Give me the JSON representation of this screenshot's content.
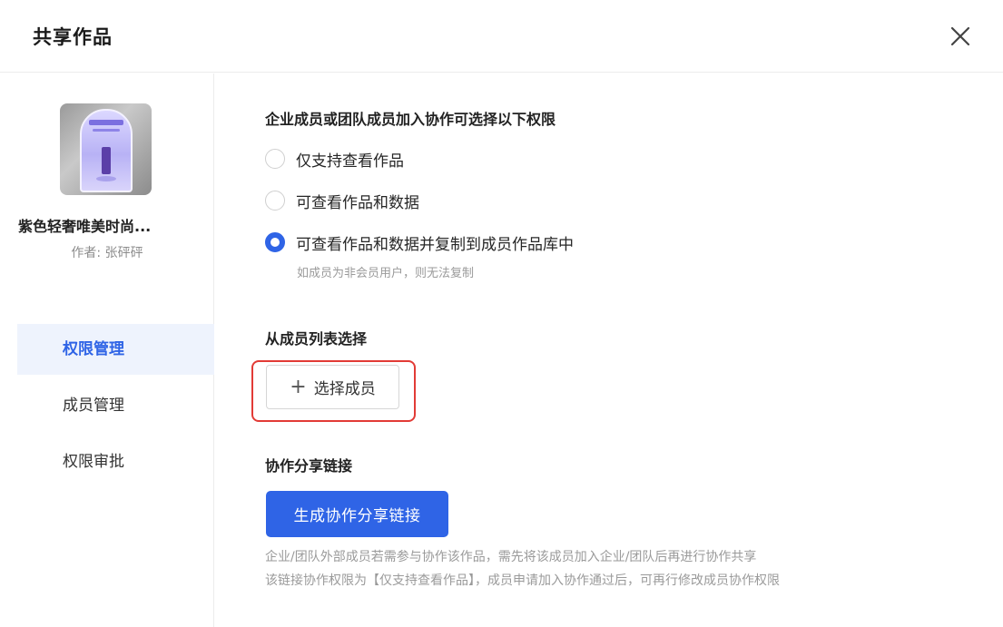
{
  "dialog": {
    "title": "共享作品",
    "close_icon": "close-icon"
  },
  "work": {
    "name": "紫色轻奢唯美时尚...",
    "author_label": "作者:",
    "author_name": "张砰砰",
    "thumbnail_colors": {
      "accent": "#7b6fe0",
      "frame": "#dcd8ff"
    }
  },
  "sidebar": {
    "items": [
      {
        "label": "权限管理",
        "active": true
      },
      {
        "label": "成员管理",
        "active": false
      },
      {
        "label": "权限审批",
        "active": false
      }
    ]
  },
  "permissions": {
    "heading": "企业成员或团队成员加入协作可选择以下权限",
    "options": [
      {
        "label": "仅支持查看作品",
        "checked": false
      },
      {
        "label": "可查看作品和数据",
        "checked": false
      },
      {
        "label": "可查看作品和数据并复制到成员作品库中",
        "checked": true
      }
    ],
    "hint": "如成员为非会员用户，则无法复制"
  },
  "member_select": {
    "heading": "从成员列表选择",
    "button_label": "选择成员",
    "plus_icon": "plus-icon"
  },
  "share_link": {
    "heading": "协作分享链接",
    "button_label": "生成协作分享链接",
    "notes": [
      "企业/团队外部成员若需参与协作该作品，需先将该成员加入企业/团队后再进行协作共享",
      "该链接协作权限为【仅支持查看作品】，成员申请加入协作通过后，可再行修改成员协作权限"
    ]
  },
  "colors": {
    "primary": "#2f64e6",
    "highlight": "#e23b36",
    "active_bg": "#eef3fd"
  }
}
